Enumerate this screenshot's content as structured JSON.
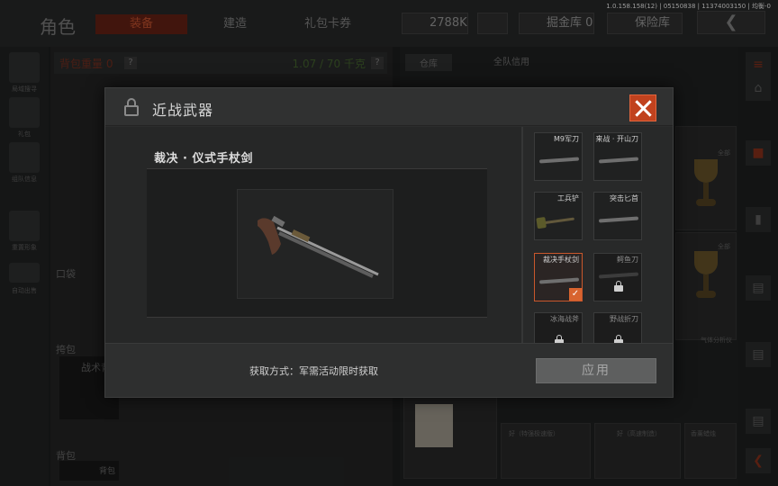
{
  "version": "1.0.158.158(12) | 05150838 | 11374003150 | 均衡-0",
  "top": {
    "title": "角色",
    "tabs": [
      "装备",
      "建造",
      "礼包卡券"
    ],
    "money": "2788K",
    "vault_label": "掘金库 0",
    "safe_label": "保险库"
  },
  "left": {
    "rail_labels": [
      "局域搜寻",
      "礼包",
      "组队信息",
      "重置形象",
      "自动出售"
    ],
    "weight_left": "背包重量 0",
    "weight_right": "1.07 / 70 千克",
    "pocket_label": "口袋",
    "sidearm_label": "挎包",
    "tactical_label": "战术背",
    "backpack_label": "背包",
    "backpack_sub": "背包"
  },
  "right": {
    "tabs": [
      "仓库",
      "全队信用"
    ],
    "cell_labels": [
      "全部",
      "全部",
      "气体分析仪",
      "好（特强极速版）",
      "好（高速制造）",
      "香薰蜡烛"
    ]
  },
  "modal": {
    "title": "近战武器",
    "selected_name": "裁决 · 仪式手杖剑",
    "acquire_text": "获取方式：军需活动限时获取",
    "apply_label": "应用",
    "weapons": [
      {
        "label": "M9军刀",
        "locked": false,
        "selected": false
      },
      {
        "label": "来战 · 开山刀",
        "locked": false,
        "selected": false
      },
      {
        "label": "工兵铲",
        "locked": false,
        "selected": false
      },
      {
        "label": "突击匕首",
        "locked": false,
        "selected": false
      },
      {
        "label": "裁决手杖剑",
        "locked": false,
        "selected": true
      },
      {
        "label": "鳄鱼刀",
        "locked": true,
        "selected": false
      },
      {
        "label": "冰海战斧",
        "locked": true,
        "selected": false
      },
      {
        "label": "野战折刀",
        "locked": true,
        "selected": false
      }
    ]
  },
  "colors": {
    "accent": "#c1421e",
    "selected_border": "#c9572c",
    "check": "#d8642f"
  }
}
